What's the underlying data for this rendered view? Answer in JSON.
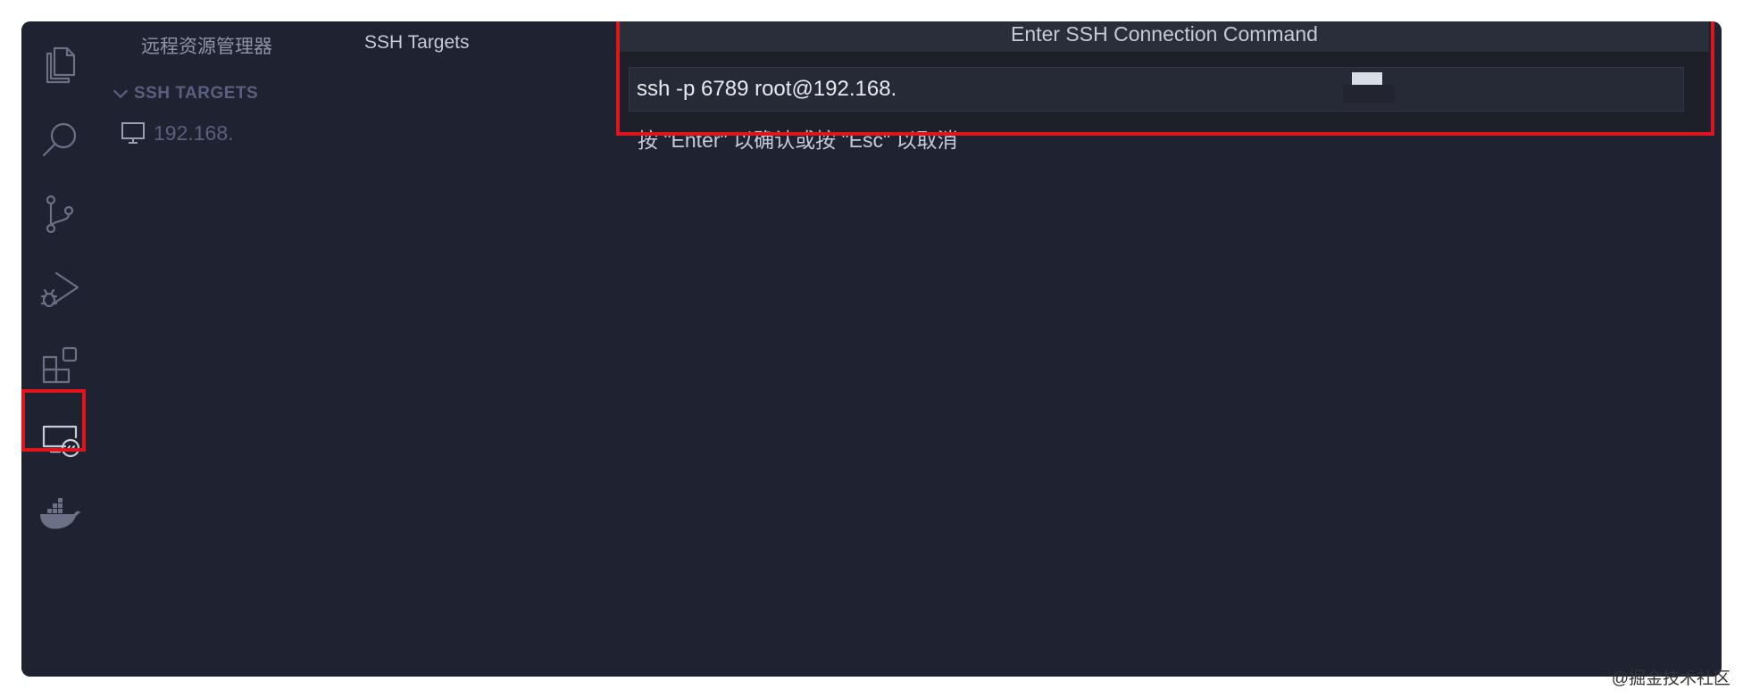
{
  "sidebar": {
    "tabs": [
      {
        "label": "远程资源管理器"
      },
      {
        "label": "SSH Targets"
      }
    ],
    "section_title": "SSH TARGETS",
    "items": [
      {
        "label": "192.168."
      }
    ]
  },
  "quick_input": {
    "title": "Enter SSH Connection Command",
    "value": "ssh -p 6789 root@192.168.",
    "hint": "按 \"Enter\" 以确认或按 \"Esc\" 以取消"
  },
  "activity_bar": {
    "icons": [
      "files-icon",
      "search-icon",
      "source-control-icon",
      "run-debug-icon",
      "extensions-icon",
      "remote-explorer-icon",
      "docker-icon"
    ],
    "active": "remote-explorer-icon"
  },
  "highlight_color": "#e0151b",
  "watermark": "@掘金技术社区"
}
